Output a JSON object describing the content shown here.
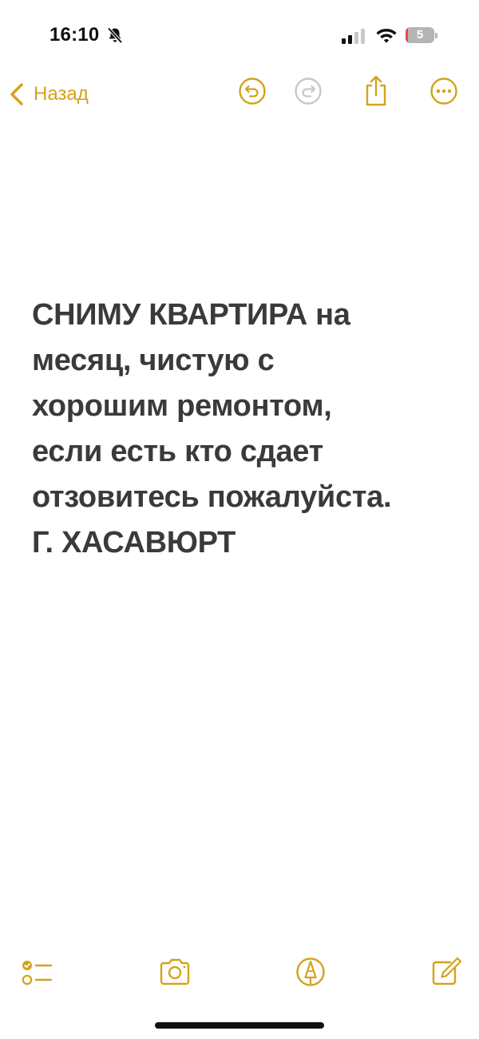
{
  "status_bar": {
    "time": "16:10",
    "battery_level": "5",
    "battery_fraction": 0.05,
    "mute_icon": "bell-slash-icon",
    "signal_icon": "cellular-signal-icon",
    "wifi_icon": "wifi-icon"
  },
  "nav": {
    "back_label": "Назад",
    "icons": [
      "undo-icon",
      "redo-icon",
      "share-icon",
      "more-icon"
    ]
  },
  "note": {
    "text": "СНИМУ КВАРТИРА на\nмесяц, чистую с\nхорошим ремонтом,\nесли есть кто сдает\nотзовитесь пожалуйста.\nГ. ХАСАВЮРТ"
  },
  "toolbar": {
    "icons": [
      "checklist-icon",
      "camera-icon",
      "markup-pen-icon",
      "compose-icon"
    ]
  },
  "colors": {
    "accent": "#d4a21a",
    "text": "#3a3a3a",
    "disabled": "#c8c8c8",
    "battery_low": "#e5494a"
  }
}
